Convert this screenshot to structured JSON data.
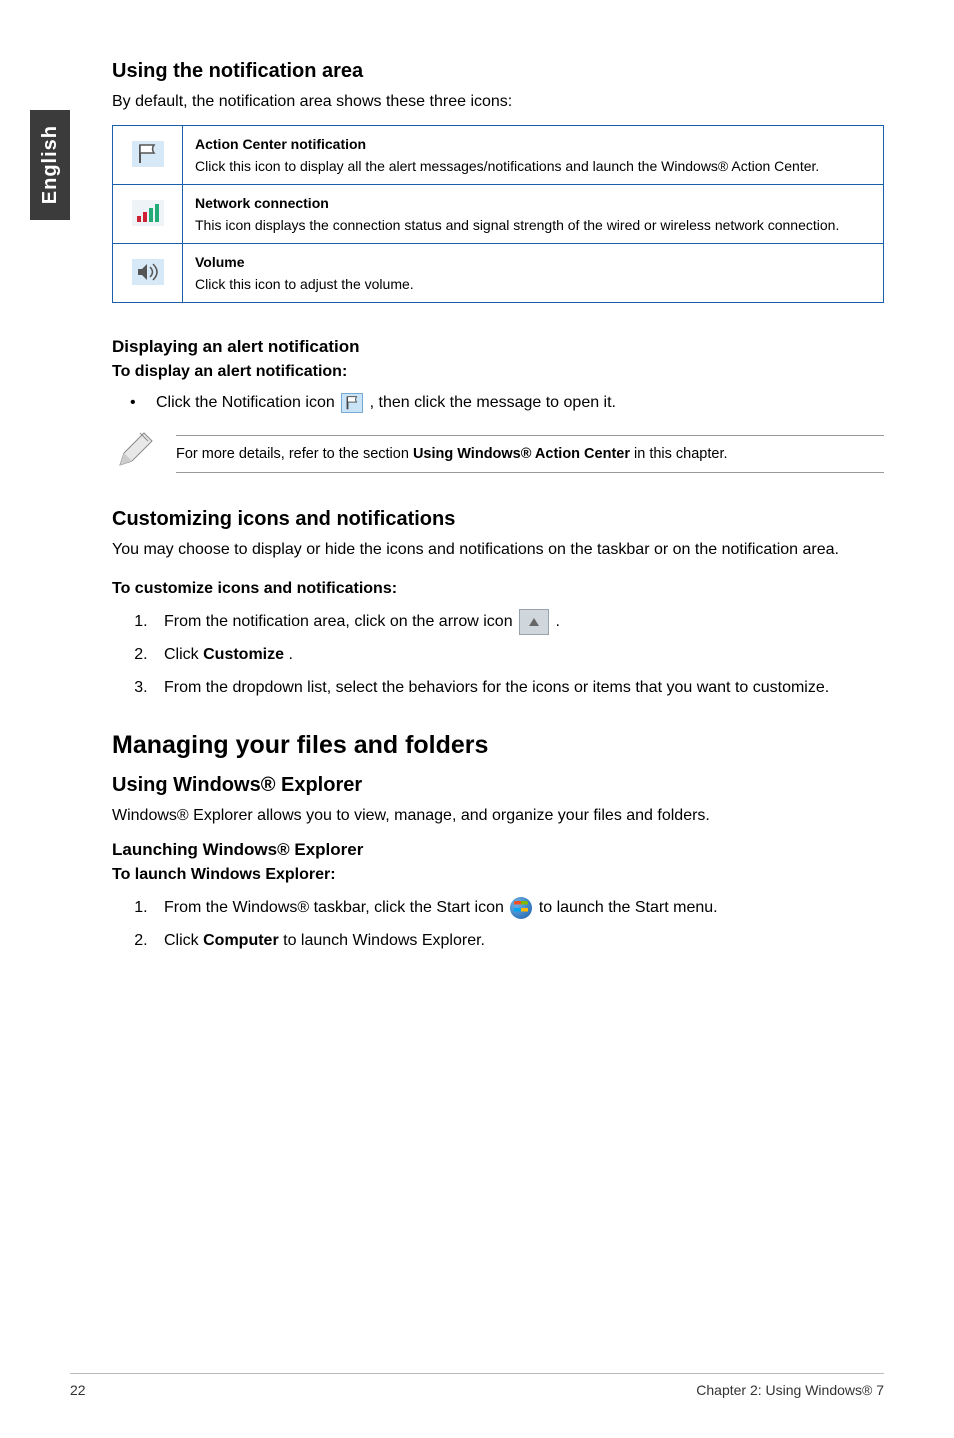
{
  "sideTab": "English",
  "sec1": {
    "title": "Using the notification area",
    "intro": "By default, the notification area shows these three icons:"
  },
  "iconTable": {
    "rows": [
      {
        "iconName": "action-center-flag-icon",
        "title": "Action Center notification",
        "desc": "Click this icon to display all the alert messages/notifications and launch the Windows® Action Center."
      },
      {
        "iconName": "network-connection-icon",
        "title": "Network connection",
        "desc": "This icon displays the connection status and signal strength of the wired or wireless network connection."
      },
      {
        "iconName": "volume-icon",
        "title": "Volume",
        "desc": "Click this icon to adjust the volume."
      }
    ]
  },
  "alert": {
    "heading": "Displaying an alert notification",
    "sub": "To display an alert notification:",
    "bullet_pre": "Click the Notification icon ",
    "bullet_post": ", then click the message to open it."
  },
  "note": {
    "pre": "For more details, refer to the section ",
    "bold": "Using Windows® Action Center",
    "post": " in this chapter."
  },
  "customize": {
    "title": "Customizing icons and notifications",
    "intro": "You may choose to display or hide the icons and notifications on the taskbar or on the notification area.",
    "sub": "To customize icons and notifications:",
    "step1_pre": "From the notification area, click on the arrow icon ",
    "step1_post": ".",
    "step2_pre": "Click ",
    "step2_bold": "Customize",
    "step2_post": ".",
    "step3": "From the dropdown list, select the behaviors for the icons or items that you want to customize."
  },
  "manage": {
    "title": "Managing your files and folders",
    "sub1": "Using Windows® Explorer",
    "intro": "Windows® Explorer allows you to view, manage, and organize your files and folders.",
    "sub2": "Launching Windows® Explorer",
    "sub3": "To launch Windows Explorer:",
    "step1_pre": "From the Windows® taskbar, click the Start icon ",
    "step1_post": " to launch the Start menu.",
    "step2_pre": "Click ",
    "step2_bold": "Computer",
    "step2_post": " to launch Windows Explorer."
  },
  "footer": {
    "page": "22",
    "chapter": "Chapter 2: Using Windows® 7"
  }
}
